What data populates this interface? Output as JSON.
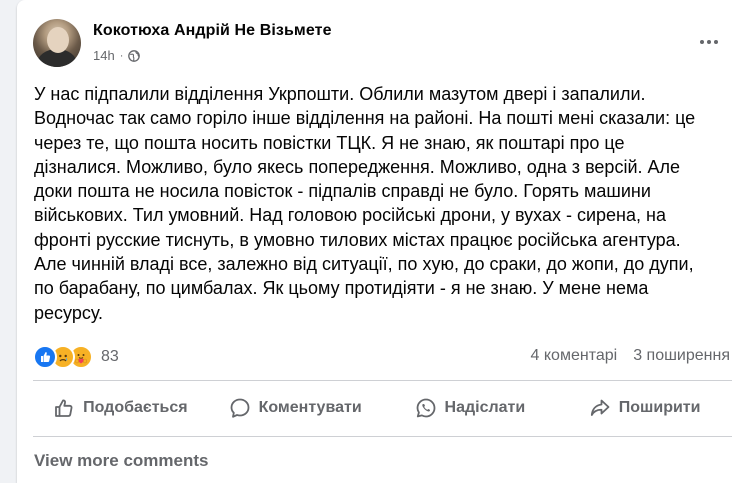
{
  "post": {
    "author": "Кокотюха Андрій Не Візьмете",
    "time": "14h",
    "separator": "·",
    "text": "У нас підпалили відділення Укрпошти. Облили мазутом двері і запалили.\nВодночас так само горіло інше відділення на районі. На пошті мені сказали: це\nчерез те, що пошта носить повістки ТЦК. Я не знаю, як поштарі про це\nдізналися. Можливо, було якесь попередження. Можливо, одна з версій. Але\nдоки пошта не носила повісток - підпалів справді не було. Горять машини\nвійськових. Тил умовний. Над головою російські дрони, у вухах - сирена, на\nфронті русские тиснуть, в умовно тилових містах працює російська агентура.\nАле чинній владі все, залежно від ситуації, по хую, до сраки, до жопи, до дупи,\nпо барабану, по цимбалах. Як цьому протидіяти - я не знаю. У мене нема\nресурсу."
  },
  "reactions": {
    "count": "83",
    "types": [
      "like-icon",
      "sad-icon",
      "care-icon"
    ]
  },
  "stats": {
    "comments": "4 коментарі",
    "shares": "3 поширення"
  },
  "actions": {
    "like": "Подобається",
    "comment": "Коментувати",
    "send": "Надіслати",
    "share": "Поширити"
  },
  "footer": {
    "view_more": "View more comments"
  },
  "colors": {
    "like_blue": "#1877f2",
    "emoji_yellow": "#f7b125",
    "secondary_text": "#65676b"
  }
}
